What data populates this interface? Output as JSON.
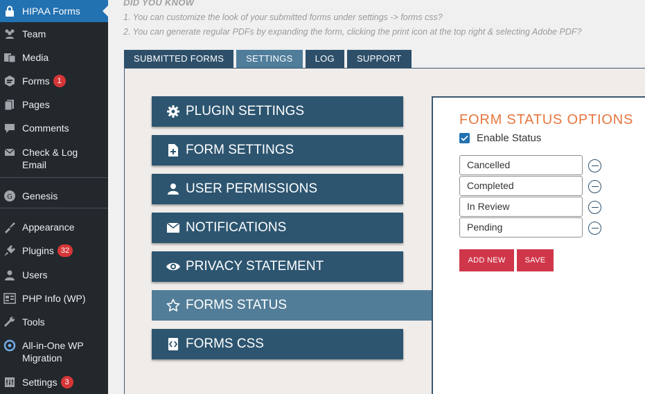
{
  "sidebar": {
    "items": [
      {
        "label": "HIPAA Forms",
        "icon": "lock-icon",
        "active": true
      },
      {
        "label": "Team",
        "icon": "team-icon"
      },
      {
        "label": "Media",
        "icon": "media-icon"
      },
      {
        "label": "Forms",
        "icon": "forms-icon",
        "badge": "1"
      },
      {
        "label": "Pages",
        "icon": "pages-icon"
      },
      {
        "label": "Comments",
        "icon": "comments-icon"
      },
      {
        "label": "Check & Log Email",
        "icon": "email-icon"
      },
      {
        "label": "Genesis",
        "icon": "genesis-icon"
      },
      {
        "label": "Appearance",
        "icon": "appearance-icon"
      },
      {
        "label": "Plugins",
        "icon": "plugins-icon",
        "badge": "32"
      },
      {
        "label": "Users",
        "icon": "users-icon"
      },
      {
        "label": "PHP Info (WP)",
        "icon": "php-info-icon"
      },
      {
        "label": "Tools",
        "icon": "tools-icon"
      },
      {
        "label": "All-in-One WP Migration",
        "icon": "migration-icon"
      },
      {
        "label": "Settings",
        "icon": "settings-icon",
        "badge": "3"
      }
    ]
  },
  "did_you_know": {
    "title": "DID YOU KNOW",
    "tips": [
      "1. You can customize the look of your submitted forms under settings -> forms css?",
      "2. You can generate regular PDFs by expanding the form, clicking the print icon at the top right & selecting Adobe PDF?"
    ]
  },
  "tabs": [
    {
      "label": "SUBMITTED FORMS"
    },
    {
      "label": "SETTINGS",
      "active": true
    },
    {
      "label": "LOG"
    },
    {
      "label": "SUPPORT"
    }
  ],
  "settings_menu": [
    {
      "label": "PLUGIN SETTINGS",
      "icon": "gear-icon"
    },
    {
      "label": "FORM SETTINGS",
      "icon": "file-plus-icon"
    },
    {
      "label": "USER PERMISSIONS",
      "icon": "user-icon"
    },
    {
      "label": "NOTIFICATIONS",
      "icon": "envelope-icon"
    },
    {
      "label": "PRIVACY STATEMENT",
      "icon": "eye-icon"
    },
    {
      "label": "FORMS STATUS",
      "icon": "star-icon",
      "active": true
    },
    {
      "label": "FORMS CSS",
      "icon": "code-file-icon"
    }
  ],
  "form_status": {
    "title": "FORM STATUS OPTIONS",
    "enable_label": "Enable Status",
    "enabled": true,
    "options": [
      "Cancelled",
      "Completed",
      "In Review",
      "Pending"
    ],
    "add_new_label": "ADD NEW",
    "save_label": "SAVE"
  },
  "colors": {
    "sidebar_bg": "#23282d",
    "active_menu": "#2271b1",
    "accent_orange": "#e6773f",
    "button_red": "#d0364a",
    "nav_dark": "#2d5570"
  }
}
